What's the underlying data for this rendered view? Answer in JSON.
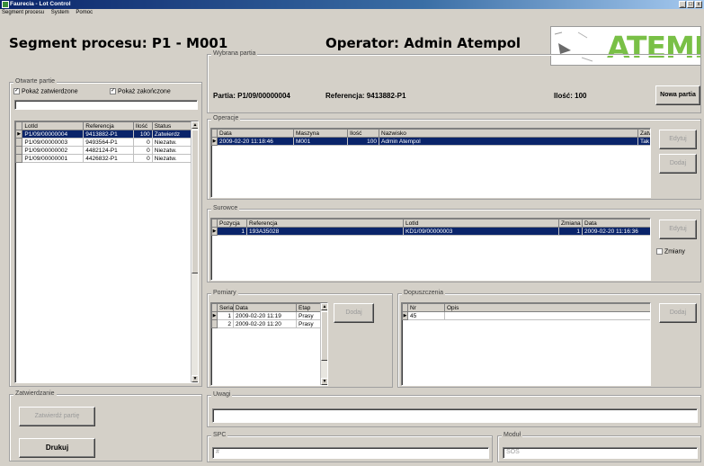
{
  "window": {
    "title": "Faurecia - Lot Control",
    "min": "_",
    "max": "□",
    "close": "x"
  },
  "menu": [
    "Segment procesu",
    "System",
    "Pomoc"
  ],
  "header": {
    "segment": "Segment procesu: P1 - M001",
    "operator": "Operator: Admin Atempol",
    "logo": "ATEMPOL"
  },
  "otwarte_partie": {
    "label": "Otwarte partie",
    "show_confirmed": "Pokaż zatwierdzone",
    "show_finished": "Pokaż zakończone",
    "columns": [
      "LotId",
      "Referencja",
      "Ilość",
      "Status"
    ],
    "rows": [
      [
        "P1/09/00000004",
        "9413882-P1",
        "100",
        "Zatwierdz"
      ],
      [
        "P1/09/00000003",
        "9493564-P1",
        "0",
        "Niezatw."
      ],
      [
        "P1/09/00000002",
        "4482124-P1",
        "0",
        "Niezatw."
      ],
      [
        "P1/09/00000001",
        "4426832-P1",
        "0",
        "Niezatw."
      ]
    ]
  },
  "zatwierdzanie": {
    "label": "Zatwierdzanie",
    "confirm_button": "Zatwierdź partię",
    "print_button": "Drukuj"
  },
  "wybrana_partia": {
    "label": "Wybrana partia",
    "partia": "Partia: P1/09/00000004",
    "referencja": "Referencja: 9413882-P1",
    "ilosc": "Ilość: 100",
    "new_button": "Nowa partia"
  },
  "operacje": {
    "label": "Operacje",
    "columns": [
      "Data",
      "Maszyna",
      "Ilość",
      "Nazwisko",
      "Zatwierdzona"
    ],
    "rows": [
      [
        "2009-02-20 11:18:46",
        "M001",
        "100",
        "Admin Atempol",
        "Tak"
      ]
    ],
    "edit_button": "Edytuj",
    "add_button": "Dodaj"
  },
  "surowce": {
    "label": "Surowce",
    "columns": [
      "Pozycja",
      "Referencja",
      "LotId",
      "Zmiana",
      "Data"
    ],
    "rows": [
      [
        "1",
        "193A35028",
        "KD1/09/00000003",
        "1",
        "2009-02-20 11:16:36"
      ]
    ],
    "edit_button": "Edytuj",
    "changes_checkbox": "Zmiany"
  },
  "pomiary": {
    "label": "Pomiary",
    "columns": [
      "Seria",
      "Data",
      "Etap"
    ],
    "rows": [
      [
        "1",
        "2009-02-20 11:19",
        "Prasy"
      ],
      [
        "2",
        "2009-02-20 11:20",
        "Prasy"
      ]
    ],
    "add_button": "Dodaj"
  },
  "dopuszczenia": {
    "label": "Dopuszczenia",
    "columns": [
      "Nr",
      "Opis"
    ],
    "rows": [
      [
        "45",
        ""
      ]
    ],
    "add_button": "Dodaj"
  },
  "uwagi": {
    "label": "Uwagi",
    "value": ""
  },
  "spc": {
    "label": "SPC",
    "value": "#"
  },
  "modul": {
    "label": "Moduł",
    "value": "SOS"
  },
  "icons": {
    "row_pointer": "▶",
    "check": "✓",
    "scroll_up": "▲",
    "scroll_down": "▼"
  }
}
